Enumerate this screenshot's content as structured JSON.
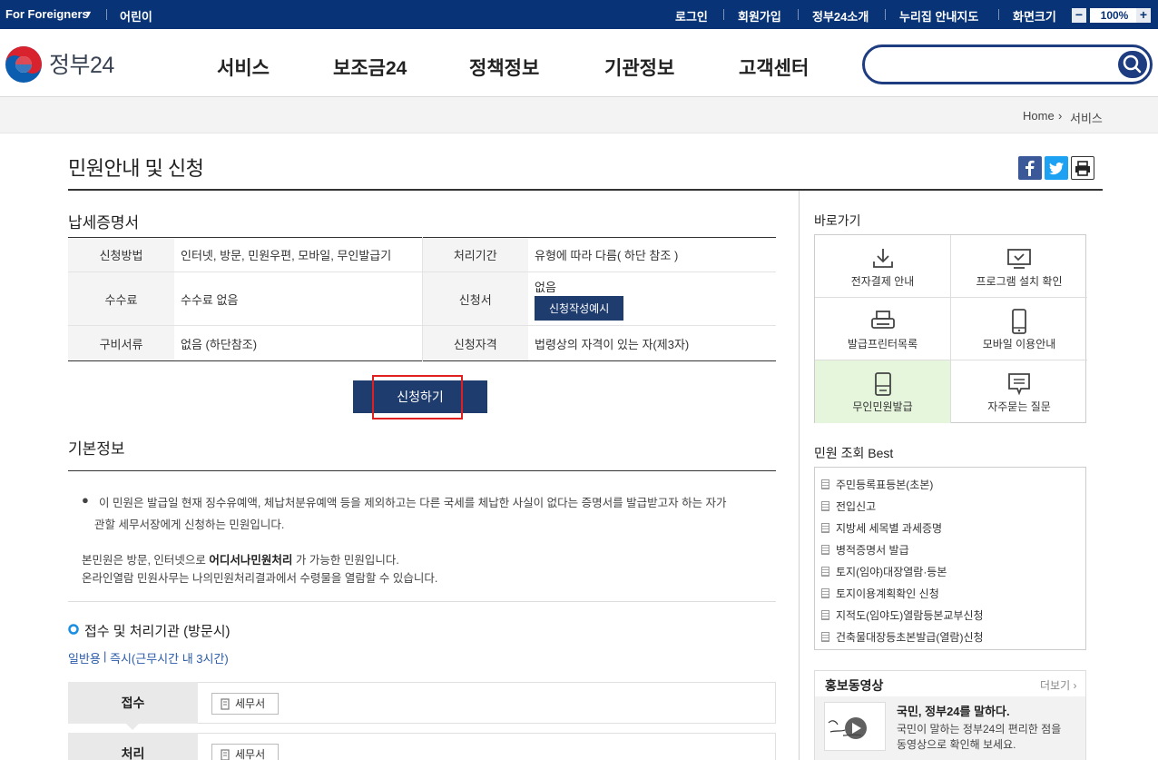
{
  "topbar": {
    "foreigners": "For Foreigners",
    "kids": "어린이",
    "login": "로그인",
    "signup": "회원가입",
    "about": "정부24소개",
    "sitemap": "누리집 안내지도",
    "screen_size": "화면크기",
    "zoom_minus": "−",
    "zoom_value": "100%",
    "zoom_plus": "+"
  },
  "header": {
    "logo": "정부24",
    "nav": [
      "서비스",
      "보조금24",
      "정책정보",
      "기관정보",
      "고객센터"
    ],
    "search_value": ""
  },
  "breadcrumb": {
    "home": "Home",
    "sep": "›",
    "current": "서비스"
  },
  "page_title": "민원안내 및 신청",
  "service": {
    "title": "납세증명서",
    "rows": [
      {
        "h1": "신청방법",
        "v1": "인터넷, 방문, 민원우편, 모바일, 무인발급기",
        "h2": "처리기간",
        "v2": "유형에 따라 다름( 하단 참조 )"
      },
      {
        "h1": "수수료",
        "v1": "수수료 없음",
        "h2": "신청서",
        "v2": "없음",
        "btn": "신청작성예시"
      },
      {
        "h1": "구비서류",
        "v1": "없음 (하단참조)",
        "h2": "신청자격",
        "v2": "법령상의 자격이 있는 자(제3자)"
      }
    ],
    "apply": "신청하기"
  },
  "basic": {
    "title": "기본정보",
    "bullet_line1": "이 민원은 발급일 현재 징수유예액, 체납처분유예액 등을 제외하고는 다른 국세를 체납한 사실이 없다는 증명서를 발급받고자 하는 자가",
    "bullet_line2": "관할 세무서장에게 신청하는 민원입니다.",
    "p1_pre": "본민원은 방문, 인터넷으로 ",
    "p1_bold": "어디서나민원처리",
    "p1_post": " 가 가능한 민원입니다.",
    "p2": "온라인열람 민원사무는 나의민원처리결과에서 수령물을 열람할 수 있습니다."
  },
  "process": {
    "title": "접수 및 처리기관 (방문시)",
    "type_a": "일반용",
    "divider": "|",
    "type_b": "즉시(근무시간 내 3시간)",
    "rows": [
      {
        "label": "접수",
        "org": "세무서"
      },
      {
        "label": "처리",
        "org": "세무서"
      }
    ]
  },
  "sidebar": {
    "quick_title": "바로가기",
    "quick": [
      {
        "label": "전자결제 안내",
        "icon": "download-icon"
      },
      {
        "label": "프로그램 설치 확인",
        "icon": "monitor-check-icon"
      },
      {
        "label": "발급프린터목록",
        "icon": "printer-icon"
      },
      {
        "label": "모바일 이용안내",
        "icon": "mobile-icon"
      },
      {
        "label": "무인민원발급",
        "icon": "kiosk-icon"
      },
      {
        "label": "자주묻는 질문",
        "icon": "speech-bubble-icon"
      }
    ],
    "best_title": "민원 조회 Best",
    "best": [
      "주민등록표등본(초본)",
      "전입신고",
      "지방세 세목별 과세증명",
      "병적증명서 발급",
      "토지(임야)대장열람·등본",
      "토지이용계획확인 신청",
      "지적도(임야도)열람등본교부신청",
      "건축물대장등초본발급(열람)신청"
    ],
    "promo_title": "홍보동영상",
    "promo_more": "더보기",
    "promo_more_arrow": "›",
    "promo_headline": "국민, 정부24를 말하다.",
    "promo_desc1": "국민이 말하는 정부24의 편리한 점을",
    "promo_desc2": "동영상으로 확인해 보세요."
  },
  "colors": {
    "navy": "#083376",
    "button": "#1f3c6e",
    "highlight": "#e6f6dc",
    "red_box": "#e02020"
  }
}
